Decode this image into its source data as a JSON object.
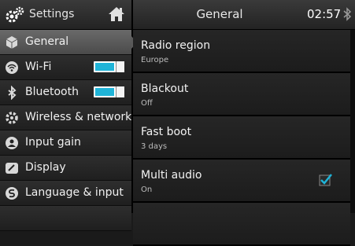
{
  "sidebar": {
    "title": "Settings",
    "items": [
      {
        "label": "General",
        "icon": "cube-icon",
        "selected": true
      },
      {
        "label": "Wi-Fi",
        "icon": "wifi-icon",
        "toggle": true
      },
      {
        "label": "Bluetooth",
        "icon": "bluetooth-icon",
        "toggle": true
      },
      {
        "label": "Wireless & network",
        "icon": "gear-icon"
      },
      {
        "label": "Input gain",
        "icon": "person-icon"
      },
      {
        "label": "Display",
        "icon": "display-icon"
      },
      {
        "label": "Language & input",
        "icon": "language-icon"
      }
    ]
  },
  "header": {
    "title": "General",
    "time": "02:57"
  },
  "settings": [
    {
      "title": "Radio region",
      "value": "Europe"
    },
    {
      "title": "Blackout",
      "value": "Off"
    },
    {
      "title": "Fast boot",
      "value": "3 days"
    },
    {
      "title": "Multi audio",
      "value": "On",
      "checked": true
    }
  ],
  "colors": {
    "accent": "#1fb4d8",
    "selected": "#5a5a5a",
    "background": "#1a1a1a"
  }
}
